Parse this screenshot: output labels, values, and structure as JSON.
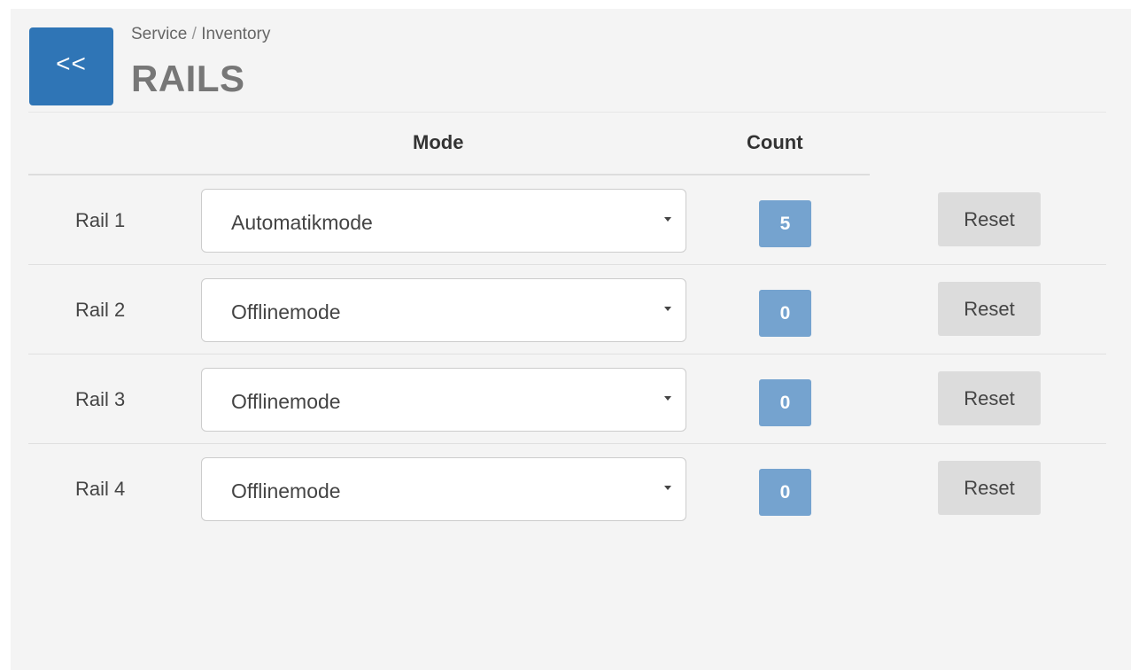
{
  "header": {
    "back_label": "<<",
    "breadcrumb": {
      "parent": "Service",
      "separator": "/",
      "current": "Inventory"
    },
    "title": "RAILS"
  },
  "table": {
    "columns": {
      "mode": "Mode",
      "count": "Count"
    },
    "rows": [
      {
        "label": "Rail 1",
        "mode": "Automatikmode",
        "count": "5",
        "reset_label": "Reset"
      },
      {
        "label": "Rail 2",
        "mode": "Offlinemode",
        "count": "0",
        "reset_label": "Reset"
      },
      {
        "label": "Rail 3",
        "mode": "Offlinemode",
        "count": "0",
        "reset_label": "Reset"
      },
      {
        "label": "Rail 4",
        "mode": "Offlinemode",
        "count": "0",
        "reset_label": "Reset"
      }
    ]
  },
  "colors": {
    "accent": "#2f75b6",
    "badge": "#75a3cf",
    "reset_button": "#dcdcdc",
    "panel_background": "#f4f4f4"
  }
}
